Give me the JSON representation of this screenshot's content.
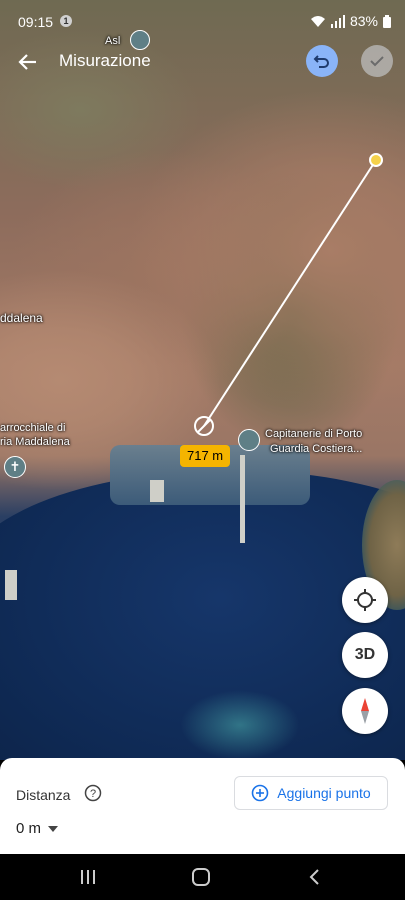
{
  "status_bar": {
    "time": "09:15",
    "notification_badge": "1",
    "battery": "83%"
  },
  "header": {
    "title": "Misurazione",
    "accent_color": "#8ab4f8"
  },
  "map": {
    "labels": {
      "asl": "Asl",
      "maddalena": "ddalena",
      "church_line1": "arrocchiale di",
      "church_line2": "ria Maddalena",
      "capitaneria_line1": "Capitanerie di Porto",
      "capitaneria_line2": "Guardia Costiera..."
    },
    "measurement_label": "717 m",
    "measurement_color": "#f5b400",
    "controls": {
      "three_d_label": "3D"
    }
  },
  "panel": {
    "distance_label": "Distanza",
    "distance_value": "0 m",
    "add_point_label": "Aggiungi punto",
    "accent_color": "#1a73e8"
  },
  "icons": [
    "back-arrow-icon",
    "undo-icon",
    "check-icon",
    "help-icon",
    "chevron-down-icon",
    "add-circle-icon",
    "my-location-icon",
    "compass-icon",
    "recents-icon",
    "home-icon",
    "nav-back-icon"
  ]
}
